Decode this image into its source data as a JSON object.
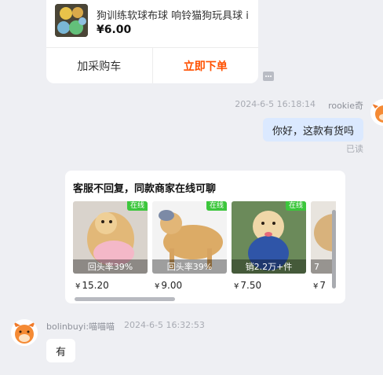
{
  "product": {
    "title": "狗训练软球布球 响铃猫狗玩具球 i",
    "price": "¥6.00",
    "add_cart_label": "加采购车",
    "buy_now_label": "立即下单"
  },
  "outgoing": {
    "timestamp": "2024-6-5 16:18:14",
    "sender": "rookie奇",
    "text": "你好，这款有货吗",
    "status": "已读"
  },
  "recommend": {
    "title": "客服不回复，同款商家在线可聊",
    "badge": "在线",
    "items": [
      {
        "caption": "回头率39%",
        "currency": "¥",
        "price": "15.20"
      },
      {
        "caption": "回头率39%",
        "currency": "¥",
        "price": "9.00"
      },
      {
        "caption": "销2.2万+件",
        "currency": "¥",
        "price": "7.50"
      },
      {
        "caption": "7",
        "currency": "¥",
        "price": "7"
      }
    ]
  },
  "incoming": {
    "sender": "bolinbuyi:喵喵喵",
    "timestamp": "2024-6-5 16:32:53",
    "text": "有"
  },
  "colors": {
    "background": "#eeeff3",
    "accent_buy": "#ff5000",
    "bubble_out": "#dbe9ff",
    "online_badge": "#3cc63c"
  }
}
